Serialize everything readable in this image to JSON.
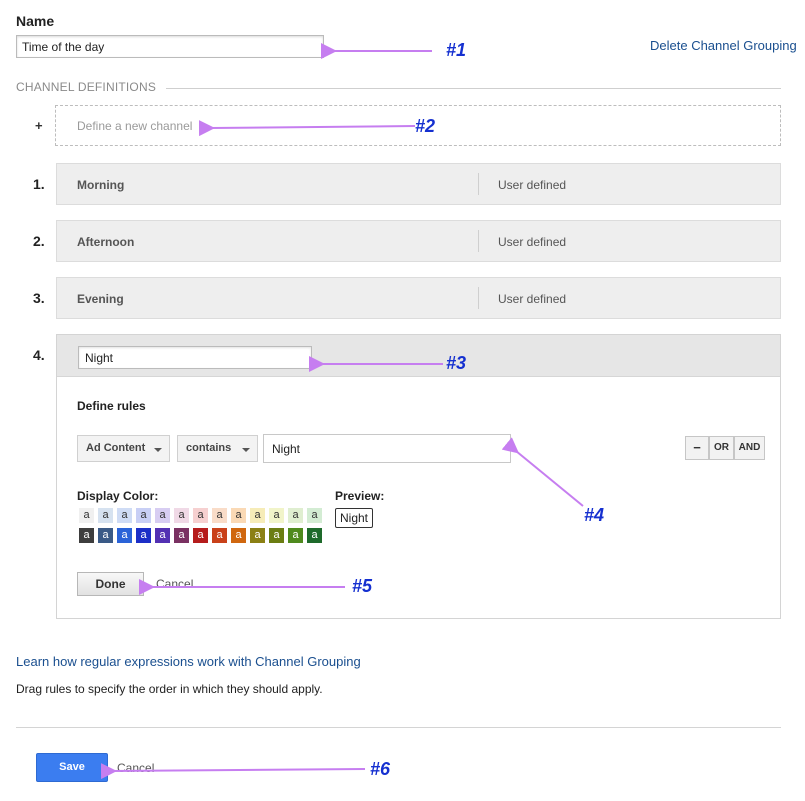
{
  "form": {
    "name_label": "Name",
    "name_value": "Time of the day",
    "delete_link": "Delete Channel Grouping"
  },
  "definitions": {
    "section_title": "CHANNEL DEFINITIONS",
    "plus": "+",
    "new_channel": "Define a new channel",
    "channels": [
      {
        "number": "1.",
        "name": "Morning",
        "type": "User defined"
      },
      {
        "number": "2.",
        "name": "Afternoon",
        "type": "User defined"
      },
      {
        "number": "3.",
        "name": "Evening",
        "type": "User defined"
      }
    ]
  },
  "editor": {
    "number": "4.",
    "channel_name": "Night",
    "define_rules": "Define rules",
    "dimension": "Ad Content",
    "operator": "contains",
    "value": "Night",
    "minus": "−",
    "or": "OR",
    "and": "AND",
    "display_color_label": "Display Color:",
    "preview_label": "Preview:",
    "preview_text": "Night",
    "swatch_letter": "a",
    "swatch_rows": [
      [
        "#f0f0f0",
        "#d6e2f0",
        "#cfdcf5",
        "#c8cff5",
        "#d7cdf2",
        "#f0d9e6",
        "#f6d0d0",
        "#f9dcc8",
        "#fad9b5",
        "#f6ecb8",
        "#f1f4c9",
        "#dfeed0",
        "#d3ecd3"
      ],
      [
        "#3d3d3d",
        "#3a5a87",
        "#2a63d8",
        "#1c2fc7",
        "#5331b3",
        "#7a3162",
        "#b51c1c",
        "#c9411a",
        "#d0670f",
        "#8b8014",
        "#6b7d12",
        "#4f8a1e",
        "#1e6a2b"
      ]
    ],
    "done": "Done",
    "cancel": "Cancel"
  },
  "footer": {
    "learn_link": "Learn how regular expressions work with Channel Grouping",
    "drag_text": "Drag rules to specify the order in which they should apply.",
    "save": "Save",
    "cancel": "Cancel"
  },
  "annotations": [
    "#1",
    "#2",
    "#3",
    "#4",
    "#5",
    "#6"
  ],
  "colors": {
    "link": "#1a4f8f",
    "save": "#3b7df0",
    "annotation": "#1530d0",
    "arrow": "#c67ef0"
  }
}
